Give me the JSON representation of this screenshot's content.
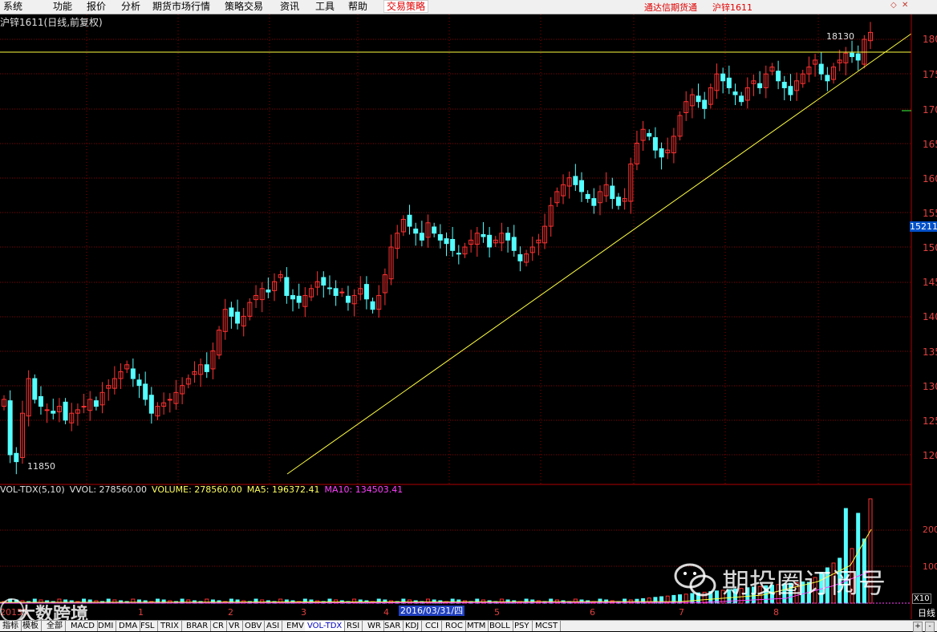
{
  "menu": {
    "items": [
      "系统",
      "功能",
      "报价",
      "分析",
      "期货市场行情",
      "策略交易",
      "资讯",
      "工具",
      "帮助",
      "交易策略"
    ],
    "right_title_1": "通达信期货通",
    "right_title_2": "沪锌1611"
  },
  "chart_data": {
    "type": "candlestick",
    "title": "沪锌1611(日线,前复权)",
    "price_axis_ticks": [
      "180",
      "175",
      "170",
      "165",
      "160",
      "155",
      "150",
      "145",
      "140",
      "135",
      "130",
      "125",
      "120"
    ],
    "current_price_tag": "15211",
    "high_annotation": "18130",
    "low_annotation": "11850",
    "volume_header": {
      "indicator": "VOL-TDX(5,10)",
      "vvol": "VVOL: 278560.00",
      "volume": "VOLUME: 278560.00",
      "ma5": "MA5: 196372.41",
      "ma10": "MA10: 134503.41"
    },
    "volume_axis_ticks": [
      "200",
      "100"
    ],
    "volume_unit_label": "X10",
    "x_labels": [
      "20155",
      "1",
      "2",
      "3",
      "4",
      "5",
      "6",
      "7",
      "8"
    ],
    "selected_date": "2016/03/31/四",
    "period_label": "日线",
    "resistance_line": 17840,
    "trendline": "ascending support",
    "colors": {
      "up": "#ff3232",
      "down": "#54ffff",
      "trendline": "#ffff40",
      "grid": "#8b0000"
    }
  },
  "tabs": [
    "指标",
    "模板",
    "全部",
    "MACD",
    "DMI",
    "DMA",
    "FSL",
    "TRIX",
    "BRAR",
    "CR",
    "VR",
    "OBV",
    "ASI",
    "EMV",
    "VOL-TDX",
    "RSI",
    "WR",
    "SAR",
    "KDJ",
    "CCI",
    "ROC",
    "MTM",
    "BOLL",
    "PSY",
    "MCST"
  ],
  "active_tab": "VOL-TDX",
  "watermark": {
    "text": "期投圈订阅号",
    "brand": "大数跨境"
  }
}
